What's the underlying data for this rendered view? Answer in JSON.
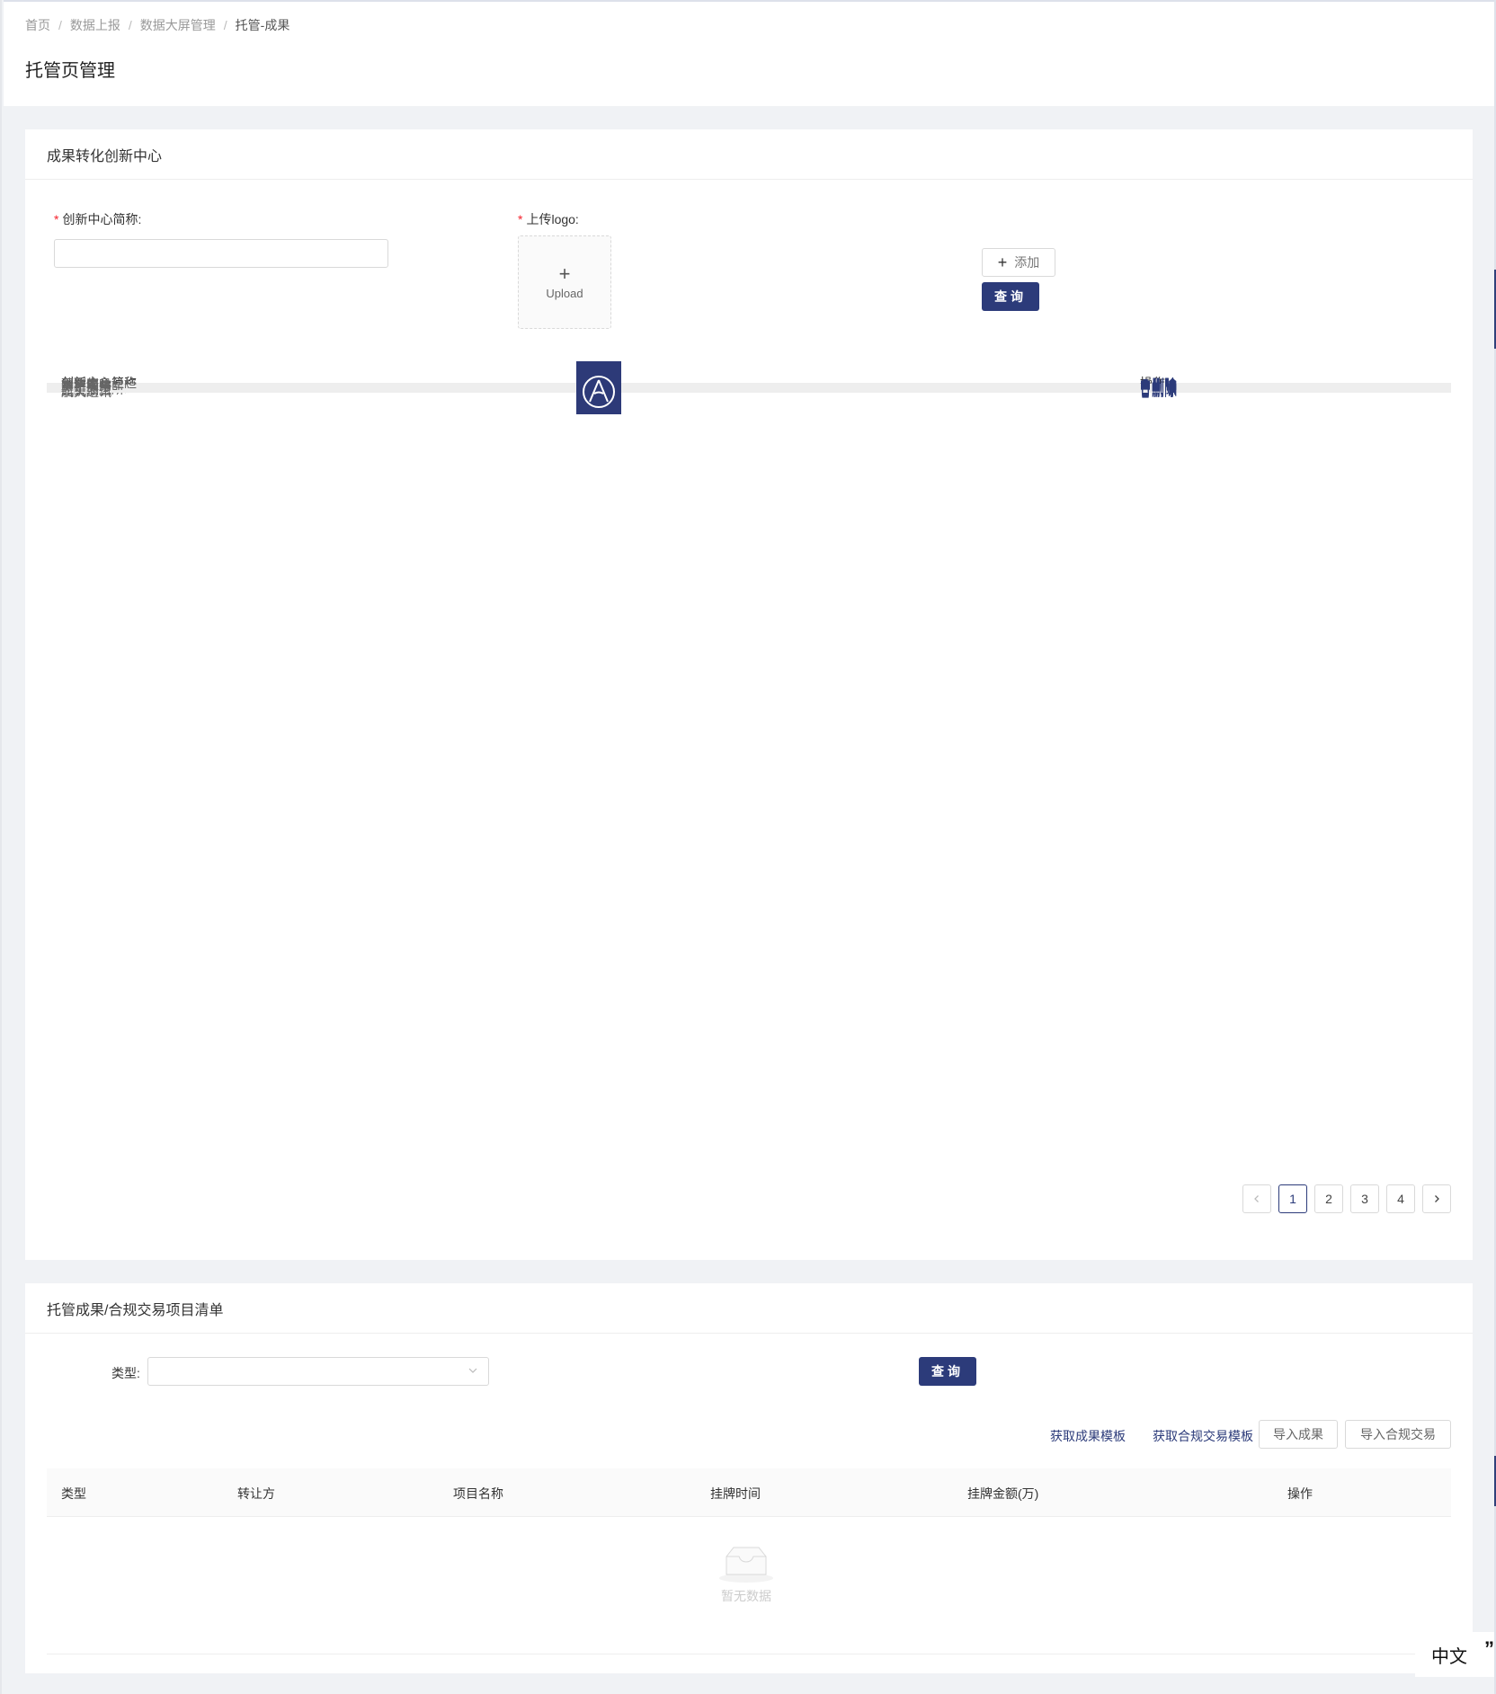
{
  "breadcrumb": [
    "首页",
    "数据上报",
    "数据大屏管理",
    "托管-成果"
  ],
  "page_title": "托管页管理",
  "section1": {
    "title": "成果转化创新中心",
    "name_label": "创新中心简称:",
    "logo_label": "上传logo:",
    "upload_text": "Upload",
    "add_button": "添加",
    "query_button": "查询",
    "columns": [
      "创新中心简称",
      "logo",
      "操作"
    ],
    "delete_label": "删除",
    "rows": [
      {
        "name": "荣耀信息科技",
        "logo": "R"
      },
      {
        "name": "水产所",
        "logo": "S"
      },
      {
        "name": "新华医院",
        "logo": "N"
      },
      {
        "name": "东方医疗",
        "logo": "G"
      },
      {
        "name": "第一人民医院",
        "logo": "shield"
      },
      {
        "name": "国合环境",
        "logo": "waves"
      },
      {
        "name": "分子细胞所",
        "logo": "CEMCS"
      },
      {
        "name": "航天测控",
        "logo": "A"
      },
      {
        "name": "光机所",
        "logo": "circle"
      },
      {
        "name": "航天通讯",
        "logo": "A"
      }
    ],
    "pages": [
      "1",
      "2",
      "3",
      "4"
    ],
    "current_page": "1"
  },
  "section2": {
    "title": "托管成果/合规交易项目清单",
    "type_label": "类型:",
    "query_button": "查询",
    "links": [
      "获取成果模板",
      "获取合规交易模板"
    ],
    "buttons": [
      "导入成果",
      "导入合规交易"
    ],
    "columns": [
      "类型",
      "转让方",
      "项目名称",
      "挂牌时间",
      "挂牌金额(万)",
      "操作"
    ],
    "empty_text": "暂无数据"
  },
  "lang_widget": "中文",
  "colors": {
    "primary": "#2c3b7a",
    "logo_bg": "#2d3a78",
    "required": "#f5222d"
  }
}
